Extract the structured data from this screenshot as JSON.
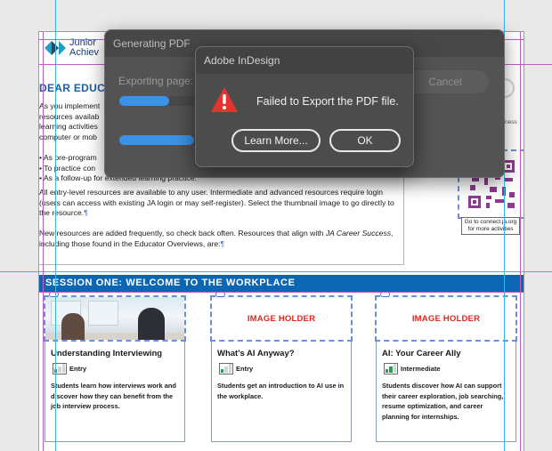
{
  "document": {
    "logo_text_line1": "Junior",
    "logo_text_line2": "Achiev",
    "greeting": "DEAR EDUC",
    "intro_lines": [
      "As you implement",
      "resources availab",
      "learning activities",
      "computer or mob"
    ],
    "bullets": [
      "As pre-program",
      "To practice con",
      "As a follow-up for extended learning practice."
    ],
    "para2": "All entry-level resources are available to any user. Intermediate and advanced resources require login (users can access with existing JA login or may self-register). Select the thumbnail image to go directly to the resource.",
    "para3_start": "New resources are added frequently, so check back often. Resources that align with ",
    "para3_italic": "JA Career Success",
    "para3_end": ", including those found in the Educator Overviews, are:",
    "pilcrow": "¶",
    "readiness_fragment": "diness",
    "qr_caption": "Go to connect.ja.org for more activities"
  },
  "session": {
    "title": "SESSION ONE: WELCOME TO THE WORKPLACE"
  },
  "cards": [
    {
      "image": "photo",
      "holder_label": "",
      "title": "Understanding Interviewing",
      "level": "Entry",
      "level_bars": 1,
      "description": "Students learn how interviews work and discover how they can benefit from the job interview process."
    },
    {
      "image": "holder",
      "holder_label": "IMAGE HOLDER",
      "title": "What's AI Anyway?",
      "level": "Entry",
      "level_bars": 1,
      "description": "Students get an introduction to AI use in the workplace."
    },
    {
      "image": "holder",
      "holder_label": "IMAGE HOLDER",
      "title": "AI: Your Career Ally",
      "level": "Intermediate",
      "level_bars": 2,
      "description": "Students discover how AI can support their career exploration, job searching, resume optimization, and career planning for internships."
    }
  ],
  "export_dialog": {
    "title": "Generating PDF",
    "status": "Exporting page:",
    "progress_top": 0.4,
    "progress_bottom": 0.6,
    "cancel_label": "Cancel"
  },
  "alert_dialog": {
    "title": "Adobe InDesign",
    "icon": "warning-icon",
    "message": "Failed to Export the PDF file.",
    "learn_more_label": "Learn More...",
    "ok_label": "OK"
  },
  "colors": {
    "session_bar": "#0d66b3",
    "heading_blue": "#1d5fa6",
    "image_holder_red": "#e1251b",
    "level_green": "#2a9d58",
    "warning_red": "#e8322e",
    "progress_blue": "#3b93e8"
  }
}
